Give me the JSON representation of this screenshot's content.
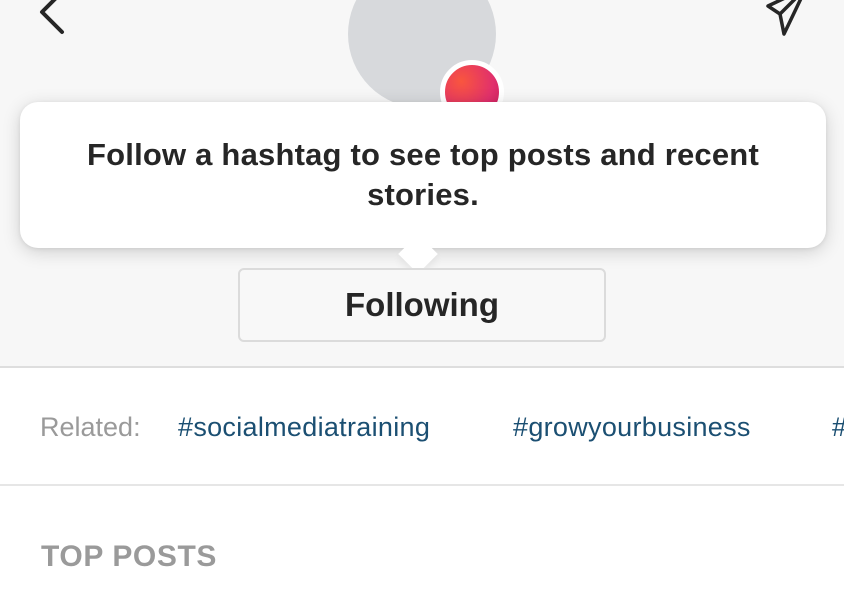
{
  "header": {
    "back_icon": "chevron-left-icon",
    "share_icon": "send-icon"
  },
  "tooltip": {
    "text": "Follow a hashtag to see top posts and recent stories."
  },
  "follow_button": {
    "label": "Following"
  },
  "related": {
    "label": "Related:",
    "tags": [
      "#socialmediatraining",
      "#growyourbusiness",
      "#"
    ]
  },
  "sections": {
    "top_posts_label": "TOP POSTS"
  },
  "colors": {
    "tag_link": "#1b4f72",
    "badge_gradient_start": "#f9563e",
    "badge_gradient_end": "#c51858"
  }
}
